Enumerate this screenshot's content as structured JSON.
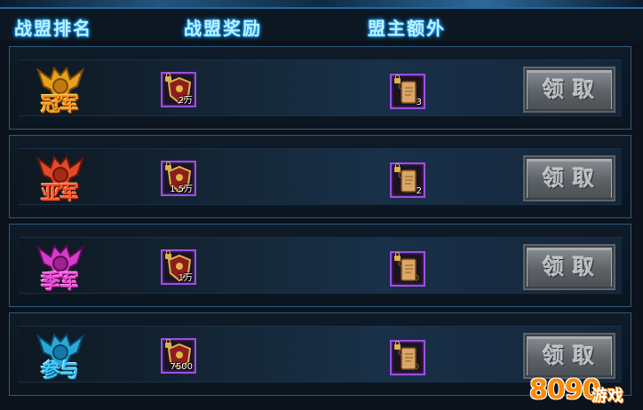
{
  "header": {
    "col_rank": "战盟排名",
    "col_reward": "战盟奖励",
    "col_leader_extra": "盟主额外"
  },
  "rows": [
    {
      "rank": "冠军",
      "reward_qty": "2万",
      "extra_qty": "3",
      "button": "领取",
      "emblem_color": "#e8a01e"
    },
    {
      "rank": "亚军",
      "reward_qty": "1.5万",
      "extra_qty": "2",
      "button": "领取",
      "emblem_color": "#e04a2a"
    },
    {
      "rank": "季军",
      "reward_qty": "1万",
      "extra_qty": "",
      "button": "领取",
      "emblem_color": "#d63cc9"
    },
    {
      "rank": "参与",
      "reward_qty": "7500",
      "extra_qty": "",
      "button": "领取",
      "emblem_color": "#2aa8d8"
    }
  ],
  "watermark": {
    "digits": "8090",
    "word": "游戏"
  },
  "icons": {
    "reward": "shield-badge-icon",
    "extra": "scroll-icon",
    "lock": "lock-icon"
  }
}
